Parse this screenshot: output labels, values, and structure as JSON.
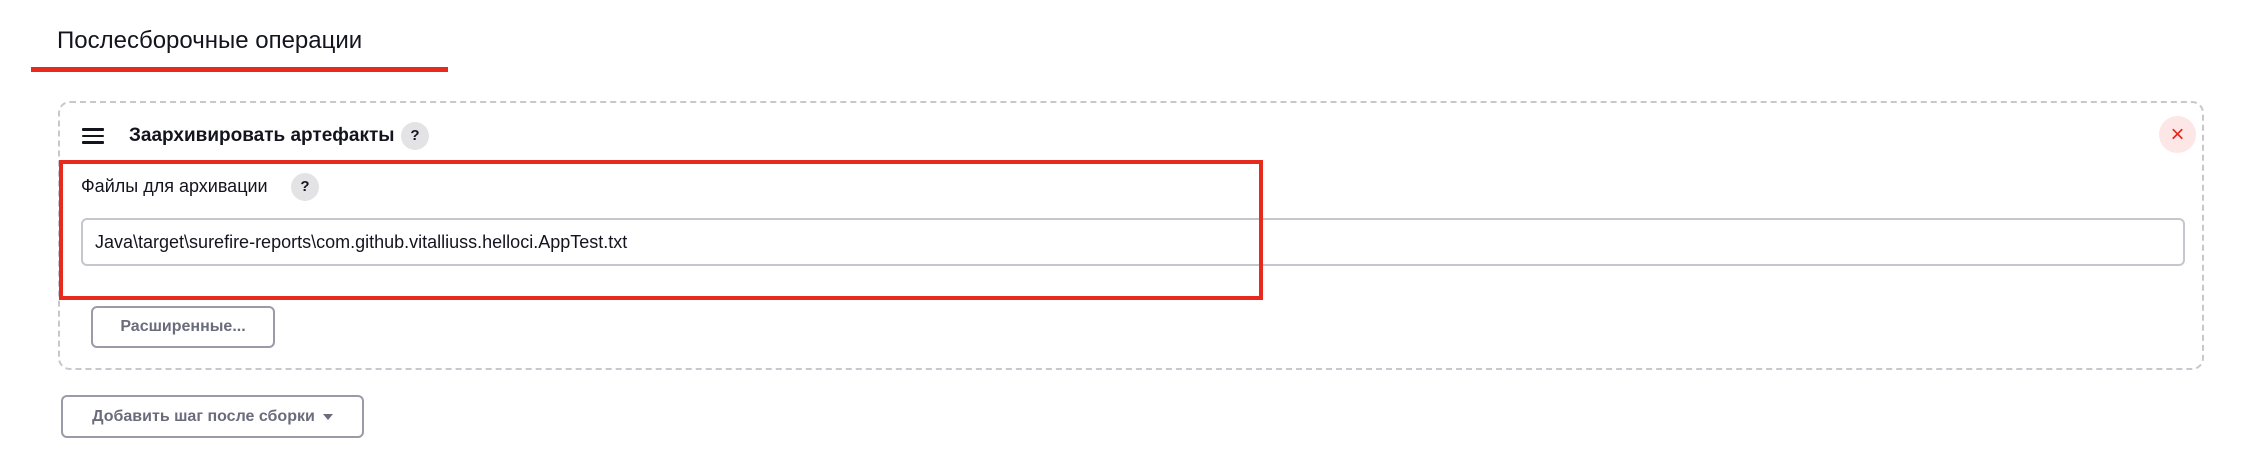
{
  "section": {
    "title": "Послесборочные операции"
  },
  "step": {
    "title": "Заархивировать артефакты",
    "help_label": "?",
    "close_label": "×",
    "files_field": {
      "label": "Файлы для архивации",
      "help_label": "?",
      "value": "Java\\target\\surefire-reports\\com.github.vitalliuss.helloci.AppTest.txt"
    },
    "advanced_label": "Расширенные..."
  },
  "add_step": {
    "label": "Добавить шаг после сборки"
  },
  "icons": {
    "drag": "drag-handle-icon",
    "help": "question-mark-icon",
    "close": "close-icon",
    "caret": "caret-down-icon"
  },
  "colors": {
    "accent_red": "#e7291e",
    "text": "#14141f",
    "muted_button_text": "#6b6c7b",
    "dashed_border": "#c7c7cd"
  }
}
